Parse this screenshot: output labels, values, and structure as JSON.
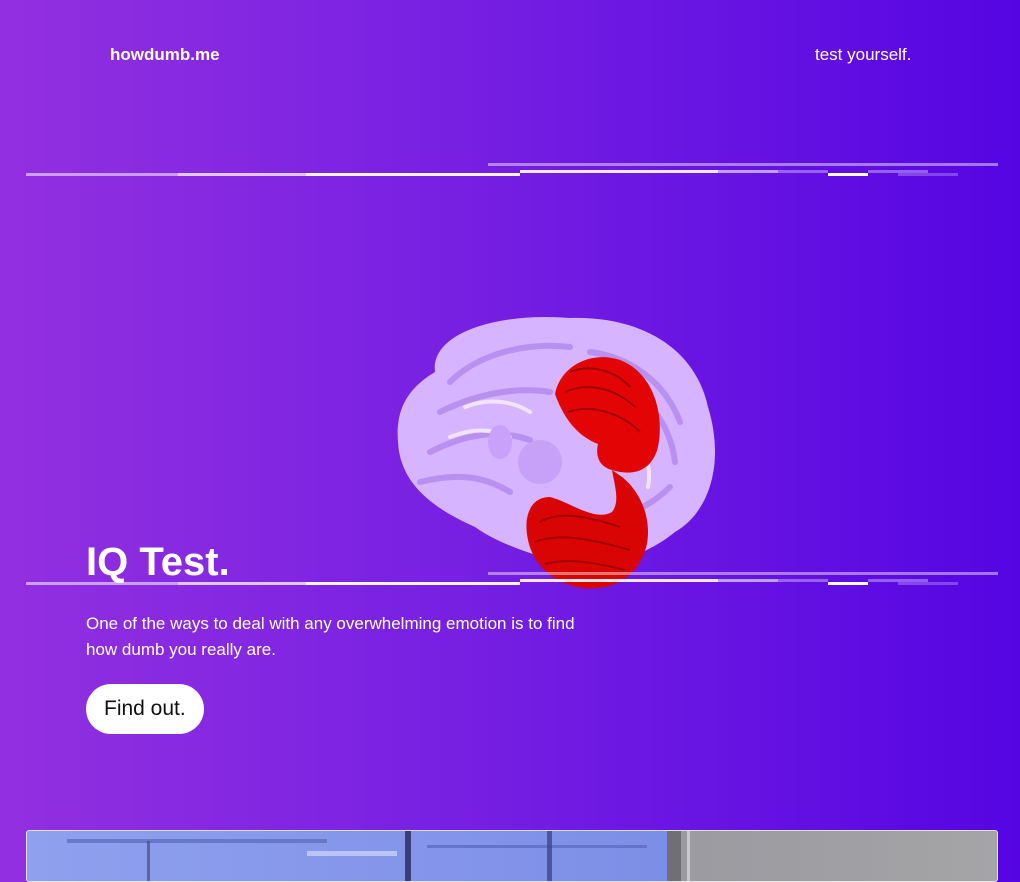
{
  "header": {
    "brand": "howdumb.me",
    "nav_link": "test yourself."
  },
  "hero": {
    "title": "IQ Test.",
    "description": "One of the ways to deal with any overwhelming emotion is to find how dumb you really are.",
    "cta_label": "Find out."
  },
  "media": {
    "hero_image": "brain-3d-illustration",
    "section_photo": "laboratory-photo"
  },
  "colors": {
    "gradient_start": "#9230e0",
    "gradient_end": "#5505e2",
    "brain_base": "#d6b4ff",
    "brain_highlight": "#e30505",
    "cta_background": "#ffffff"
  }
}
